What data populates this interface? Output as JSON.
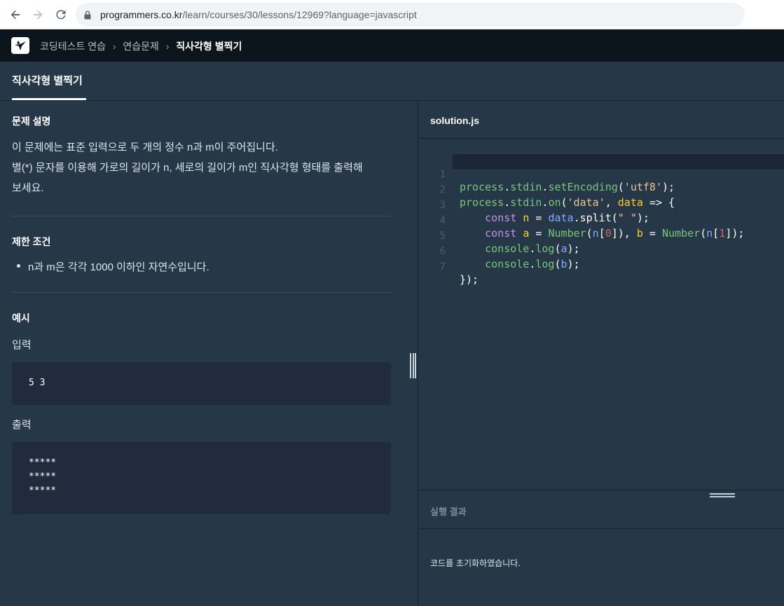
{
  "browser": {
    "url_host": "programmers.co.kr",
    "url_path": "/learn/courses/30/lessons/12969?language=javascript"
  },
  "header": {
    "breadcrumbs": [
      "코딩테스트 연습",
      "연습문제",
      "직사각형 별찍기"
    ]
  },
  "tab": {
    "label": "직사각형 별찍기"
  },
  "problem": {
    "desc_title": "문제 설명",
    "desc_line1": "이 문제에는 표준 입력으로 두 개의 정수 n과 m이 주어집니다.",
    "desc_line2": "별(*) 문자를 이용해 가로의 길이가 n, 세로의 길이가 m인 직사각형 형태를 출력해",
    "desc_line3": "보세요.",
    "limit_title": "제한 조건",
    "limit_item": "n과 m은 각각 1000 이하인 자연수입니다.",
    "example_title": "예시",
    "input_label": "입력",
    "input_value": "5 3",
    "output_label": "출력",
    "output_value": "*****\n*****\n*****"
  },
  "editor": {
    "file_name": "solution.js",
    "line_numbers": [
      "1",
      "2",
      "3",
      "4",
      "5",
      "6",
      "7"
    ]
  },
  "result": {
    "title": "실행 결과",
    "message": "코드를 초기화하였습니다."
  },
  "colors": {
    "background": "#263747",
    "header": "#0c151c",
    "code_block": "#202b3d"
  }
}
